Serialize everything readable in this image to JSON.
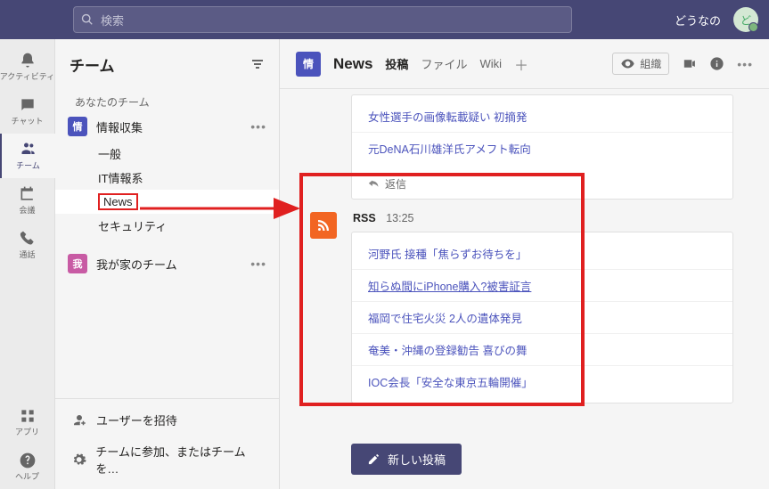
{
  "titlebar": {
    "search_placeholder": "検索",
    "username": "どうなの",
    "avatar_initial": "ど"
  },
  "rail": {
    "activity": "アクティビティ",
    "chat": "チャット",
    "teams": "チーム",
    "calendar": "会議",
    "calls": "通話",
    "apps": "アプリ",
    "help": "ヘルプ"
  },
  "side": {
    "title": "チーム",
    "section_label": "あなたのチーム",
    "team1": {
      "badge": "情",
      "name": "情報収集"
    },
    "team1_channels": {
      "c0": "一般",
      "c1": "IT情報系",
      "c2": "News",
      "c3": "セキュリティ"
    },
    "team2": {
      "badge": "我",
      "name": "我が家のチーム"
    },
    "footer_invite": "ユーザーを招待",
    "footer_join": "チームに参加、またはチームを…"
  },
  "chan": {
    "badge": "情",
    "title": "News",
    "tab_posts": "投稿",
    "tab_files": "ファイル",
    "tab_wiki": "Wiki",
    "org_button": "組織"
  },
  "prev_msg": {
    "item0": "女性選手の画像転載疑い 初摘発",
    "item1": "元DeNA石川雄洋氏アメフト転向",
    "reply": "返信"
  },
  "rss": {
    "sender": "RSS",
    "time": "13:25",
    "items": {
      "i0": "河野氏 接種「焦らずお待ちを」",
      "i1": "知らぬ間にiPhone購入?被害証言",
      "i2": "福岡で住宅火災 2人の遺体発見",
      "i3": "奄美・沖縄の登録勧告 喜びの舞",
      "i4": "IOC会長「安全な東京五輪開催」"
    }
  },
  "compose": {
    "new_post": "新しい投稿"
  }
}
